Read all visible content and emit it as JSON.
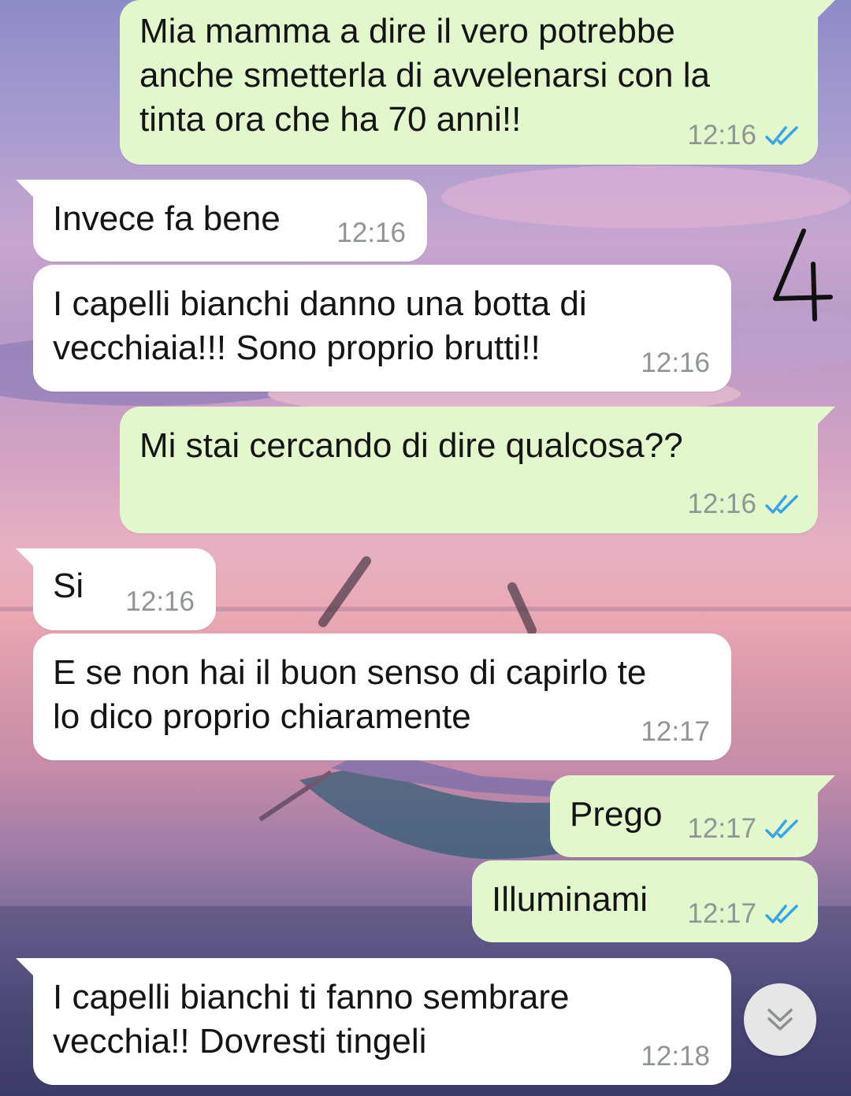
{
  "annotation": {
    "text": "4"
  },
  "messages": [
    {
      "direction": "out",
      "text": "Mia mamma a dire il vero potrebbe\nanche smetterla di avvelenarsi con la\ntinta ora che ha 70 anni!!",
      "time": "12:16",
      "status_icon": "double-check-read-icon"
    },
    {
      "direction": "in",
      "text": "Invece fa bene",
      "time": "12:16"
    },
    {
      "direction": "in",
      "text": "I capelli bianchi danno una botta di\nvecchiaia!!! Sono proprio brutti!!",
      "time": "12:16"
    },
    {
      "direction": "out",
      "text": "Mi stai cercando di dire qualcosa??",
      "time": "12:16",
      "status_icon": "double-check-read-icon"
    },
    {
      "direction": "in",
      "text": "Si",
      "time": "12:16"
    },
    {
      "direction": "in",
      "text": "E se non hai il buon senso di capirlo te\nlo dico proprio chiaramente",
      "time": "12:17"
    },
    {
      "direction": "out",
      "text": "Prego",
      "time": "12:17",
      "status_icon": "double-check-read-icon"
    },
    {
      "direction": "out",
      "text": "Illuminami",
      "time": "12:17",
      "status_icon": "double-check-read-icon"
    },
    {
      "direction": "in",
      "text": "I capelli bianchi ti fanno sembrare\nvecchia!! Dovresti tingeli",
      "time": "12:18"
    }
  ],
  "scroll_button": {
    "icon": "double-chevron-down-icon"
  },
  "colors": {
    "outgoing_bubble": "#e2f8cc",
    "incoming_bubble": "#ffffff",
    "read_ticks": "#34a6e8",
    "timestamp": "#8f9692"
  }
}
